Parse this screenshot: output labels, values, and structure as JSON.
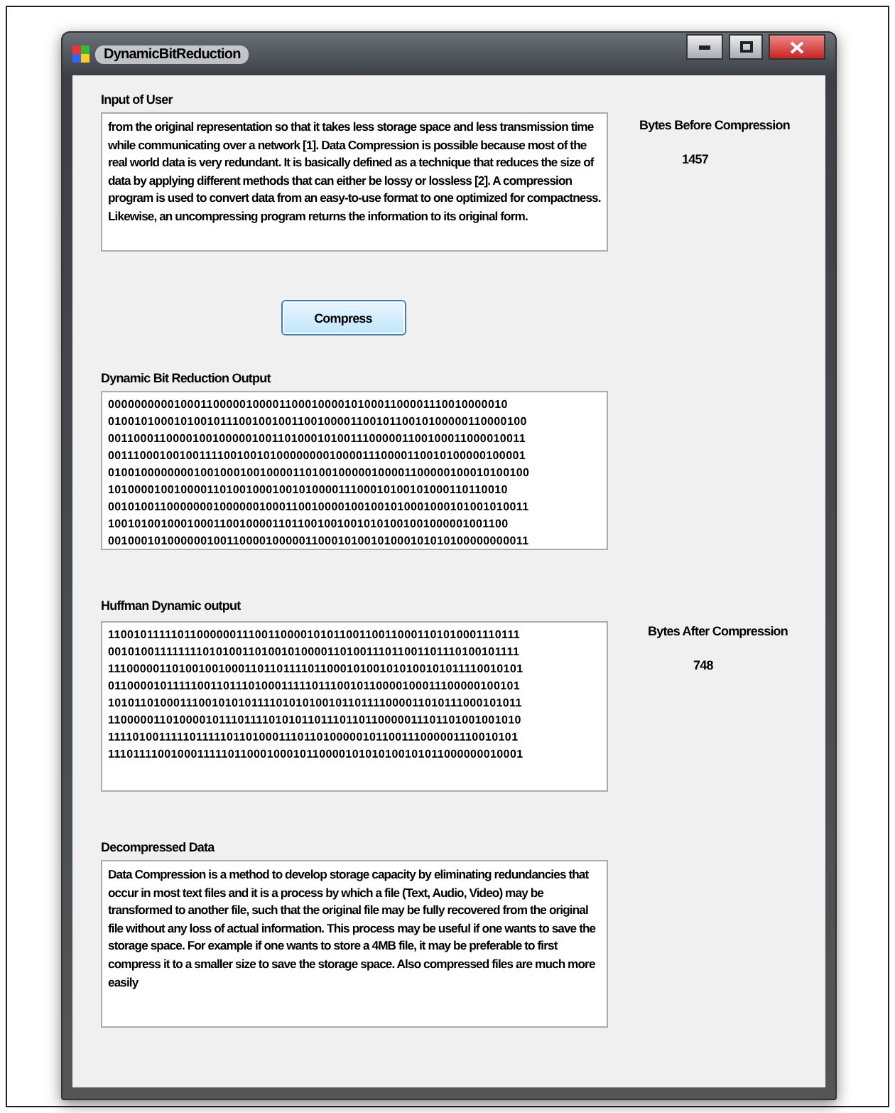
{
  "window": {
    "title": "DynamicBitReduction"
  },
  "input": {
    "label": "Input of User",
    "value": "from the original representation so that it takes less storage space and less transmission time while communicating over a network [1]. Data Compression is possible because most of the real world data is very redundant. It is basically defined as a technique that reduces the size of data by applying different methods that can either be lossy or lossless [2]. A compression program is used to convert data from an easy-to-use format to one optimized for compactness. Likewise, an uncompressing program returns the information to its original form."
  },
  "compress_button": "Compress",
  "bytes_before": {
    "label": "Bytes Before Compression",
    "value": "1457"
  },
  "dynamic_output": {
    "label": "Dynamic Bit Reduction Output",
    "lines": [
      "0000000000100011000001000011000100001010001100001110010000010",
      "0100101000101001011100100100110010000110010110010100000110000100",
      "0011000110000100100000100110100010100111000001100100011000010011",
      "0011100010010011110010010100000000100001110000110010100000100001",
      "0100100000000100100010010000110100100000100001100000100010100100",
      "1010000100100001101001000100101000011100010100101000110110010",
      "0010100110000000100000010001100100001001001010001000101001010011",
      "1001010010001000110010000110110010010010101001001000001001100",
      "0010001010000001001100001000001100010100101000101010100000000011"
    ]
  },
  "huffman_output": {
    "label": "Huffman  Dynamic output",
    "lines": [
      "1100101111101100000011100110000101011001100110001101010001110111",
      "0010100111111110101001101001010000110100111011001101110100101111",
      "1110000011010010010001101101111011000101001010100101011110010101",
      "0110000101111100110111010001111101110010110000100011100000100101",
      "1010110100011100101010111101010100101101111000011010111000101011",
      "1100000110100001011101111010101101110110110000011101101001001010",
      "1111010011111011111011010001110110100000101100111000001110010101",
      "1110111100100011111011000100010110000101010100101011000000010001"
    ]
  },
  "bytes_after": {
    "label": "Bytes After Compression",
    "value": "748"
  },
  "decompressed": {
    "label": "Decompressed Data",
    "value": "Data Compression is a method to develop storage capacity by eliminating redundancies that occur in most text files and it is a process by which a file (Text, Audio, Video) may be transformed to another file, such that the original file may be fully recovered from the original file without any loss of actual information. This process may be useful if one wants to save the storage space. For example if one wants to store a 4MB file, it may be preferable to first compress it to a smaller size to save the storage space. Also compressed files are much more easily"
  }
}
